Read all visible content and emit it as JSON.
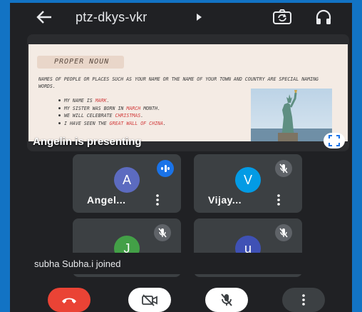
{
  "topbar": {
    "meeting_code": "ptz-dkys-vkr",
    "icons": [
      "back-arrow-icon",
      "caret-right-icon",
      "switch-camera-icon",
      "headphones-icon"
    ]
  },
  "presentation": {
    "slide": {
      "heading": "PROPER NOUN",
      "intro": "NAMES OF PEOPLE OR PLACES SUCH AS YOUR NAME OR THE NAME OF YOUR TOWN AND COUNTRY ARE SPECIAL NAMING WORDS.",
      "bullets": [
        {
          "pre": "MY NAME IS ",
          "hl": "MARK",
          "post": "."
        },
        {
          "pre": "MY SISTER WAS BORN IN ",
          "hl": "MARCH",
          "post": " MONTH."
        },
        {
          "pre": "WE WILL CELEBRATE ",
          "hl": "CHRISTMAS",
          "post": "."
        },
        {
          "pre": "I HAVE SEEN THE ",
          "hl": "GREAT WALL OF CHINA",
          "post": "."
        }
      ],
      "highlight_color": "#d23b3b",
      "image": "statue-of-liberty-photo"
    },
    "presenting_label": "Angelin is presenting"
  },
  "participants": [
    {
      "initial": "A",
      "name": "Angel...",
      "avatar_color": "#5c6bc0",
      "status": "speaking"
    },
    {
      "initial": "V",
      "name": "Vijay...",
      "avatar_color": "#039be5",
      "status": "muted"
    },
    {
      "initial": "J",
      "name": "",
      "avatar_color": "#43a047",
      "status": "muted"
    },
    {
      "initial": "u",
      "name": "",
      "avatar_color": "#3f51b5",
      "status": "muted"
    }
  ],
  "toast": {
    "message": "subha Subha.i joined"
  },
  "controls": {
    "end_call_color": "#ea4335",
    "icons": [
      "end-call-icon",
      "camera-off-icon",
      "mic-off-icon",
      "more-options-icon"
    ]
  }
}
